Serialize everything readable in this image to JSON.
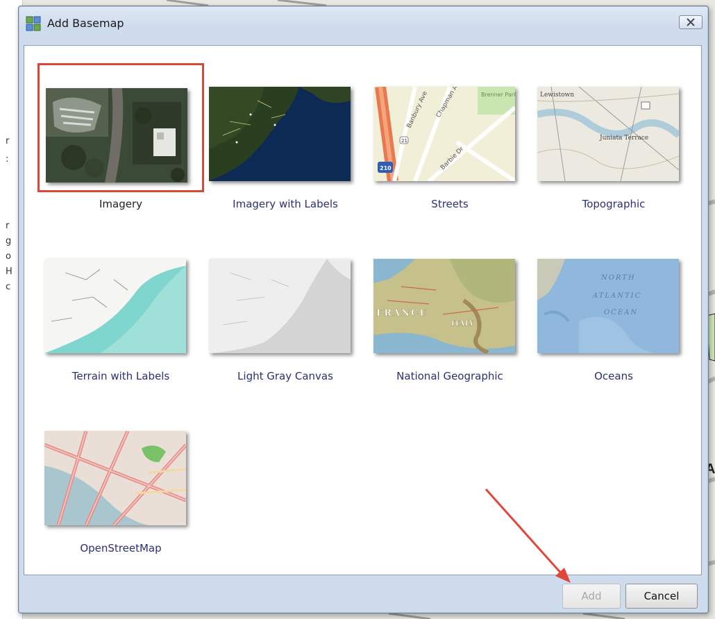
{
  "dialog": {
    "title": "Add Basemap",
    "close_icon": "close-icon"
  },
  "basemaps": [
    {
      "label": "Imagery",
      "selected": true
    },
    {
      "label": "Imagery with Labels",
      "selected": false
    },
    {
      "label": "Streets",
      "selected": false
    },
    {
      "label": "Topographic",
      "selected": false
    },
    {
      "label": "Terrain with Labels",
      "selected": false
    },
    {
      "label": "Light Gray Canvas",
      "selected": false
    },
    {
      "label": "National Geographic",
      "selected": false
    },
    {
      "label": "Oceans",
      "selected": false
    },
    {
      "label": "OpenStreetMap",
      "selected": false
    }
  ],
  "thumbnail_text": {
    "streets_park": "Brenner Park",
    "streets_ave1": "Banbury Ave",
    "streets_ave2": "Chapman Ave",
    "streets_dr": "Barbie Dr",
    "streets_shield": "210",
    "streets_shield2": "21",
    "topo_town": "Lewistown",
    "topo_place": "Juniata Terrace",
    "natgeo_france": "FRANCE",
    "natgeo_italy": "ITALY",
    "oceans_north": "NORTH",
    "oceans_atlantic": "ATLANTIC",
    "oceans_ocean": "OCEAN"
  },
  "buttons": {
    "add": "Add",
    "cancel": "Cancel"
  },
  "background": {
    "frag_letters": [
      "r",
      ":",
      "r",
      "g",
      "o",
      "H",
      "c"
    ],
    "edge_letter": "A"
  },
  "colors": {
    "selection_border": "#d7473d",
    "annotation_arrow": "#e0473a",
    "label_text": "#2a2f7a"
  }
}
